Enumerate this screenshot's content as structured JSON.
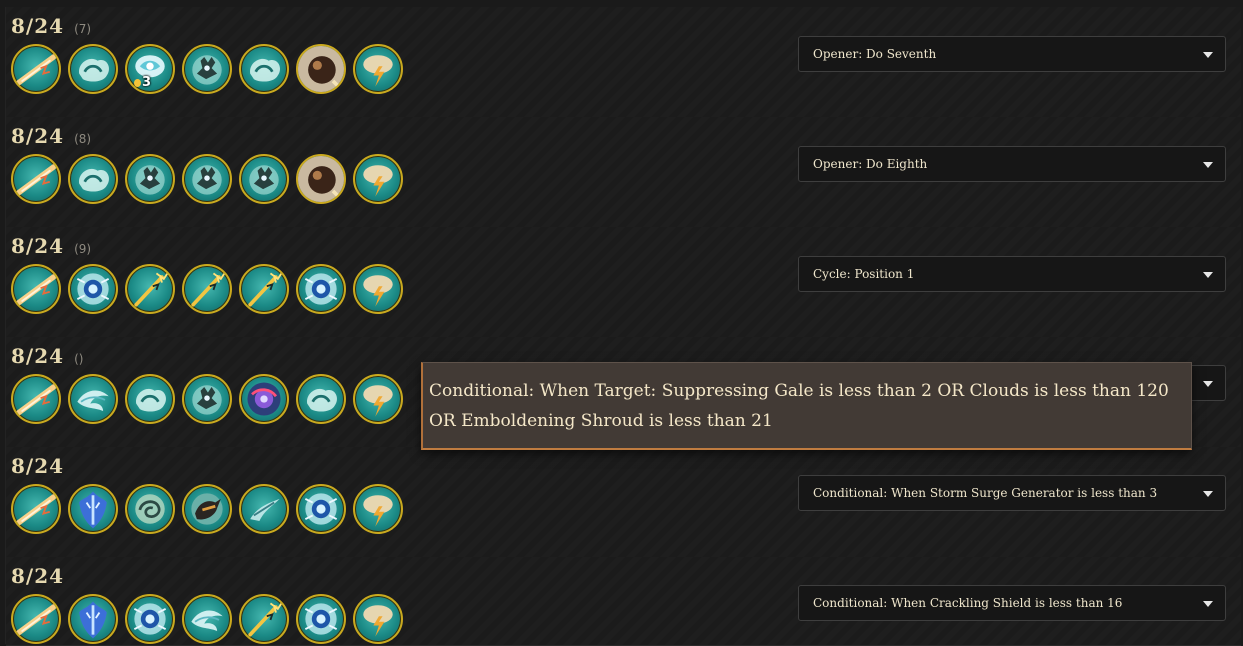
{
  "rows": [
    {
      "date": "8/24",
      "index": "(7)",
      "dropdown": "Opener: Do Seventh",
      "icons": [
        "lightning-streak-icon",
        "cloud-swirl-icon",
        "gale-charge-icon",
        "storm-spirit-icon",
        "cloud-swirl-icon",
        "meteor-orb-icon",
        "thunder-cloud-icon"
      ],
      "charge": "3"
    },
    {
      "date": "8/24",
      "index": "(8)",
      "dropdown": "Opener: Do Eighth",
      "icons": [
        "lightning-streak-icon",
        "cloud-swirl-icon",
        "storm-spirit-icon",
        "storm-spirit-icon",
        "storm-spirit-icon",
        "meteor-orb-icon",
        "thunder-cloud-icon"
      ]
    },
    {
      "date": "8/24",
      "index": "(9)",
      "dropdown": "Cycle: Position 1",
      "icons": [
        "lightning-streak-icon",
        "storm-eye-icon",
        "golden-trident-icon",
        "golden-trident-icon",
        "golden-trident-icon",
        "storm-eye-icon",
        "thunder-cloud-icon"
      ]
    },
    {
      "date": "8/24",
      "index": "()",
      "dropdown": "",
      "icons": [
        "lightning-streak-icon",
        "wind-wisp-icon",
        "cloud-swirl-icon",
        "storm-spirit-icon",
        "arcane-vortex-icon",
        "cloud-swirl-icon",
        "thunder-cloud-icon"
      ]
    },
    {
      "date": "8/24",
      "index": "",
      "dropdown": "Conditional: When Storm Surge Generator is less than 3",
      "icons": [
        "lightning-streak-icon",
        "crackling-shield-icon",
        "swirling-gust-icon",
        "storm-beast-icon",
        "wind-gust-icon",
        "storm-eye-icon",
        "thunder-cloud-icon"
      ]
    },
    {
      "date": "8/24",
      "index": "",
      "dropdown": "Conditional: When Crackling Shield is less than 16",
      "icons": [
        "lightning-streak-icon",
        "crackling-shield-icon",
        "storm-eye-icon",
        "wind-wisp-icon",
        "golden-trident-icon",
        "storm-eye-icon",
        "thunder-cloud-icon"
      ]
    }
  ],
  "tooltip": {
    "text": "Conditional: When Target: Suppressing Gale is less than 2 OR Clouds is less than 120 OR Emboldening Shroud is less than 21"
  },
  "colors": {
    "background": "#1a1a1a",
    "icon_border": "#caa91e",
    "icon_teal": "#1b8a86",
    "tooltip_bg": "#423a35",
    "text": "#e6dcc0"
  }
}
